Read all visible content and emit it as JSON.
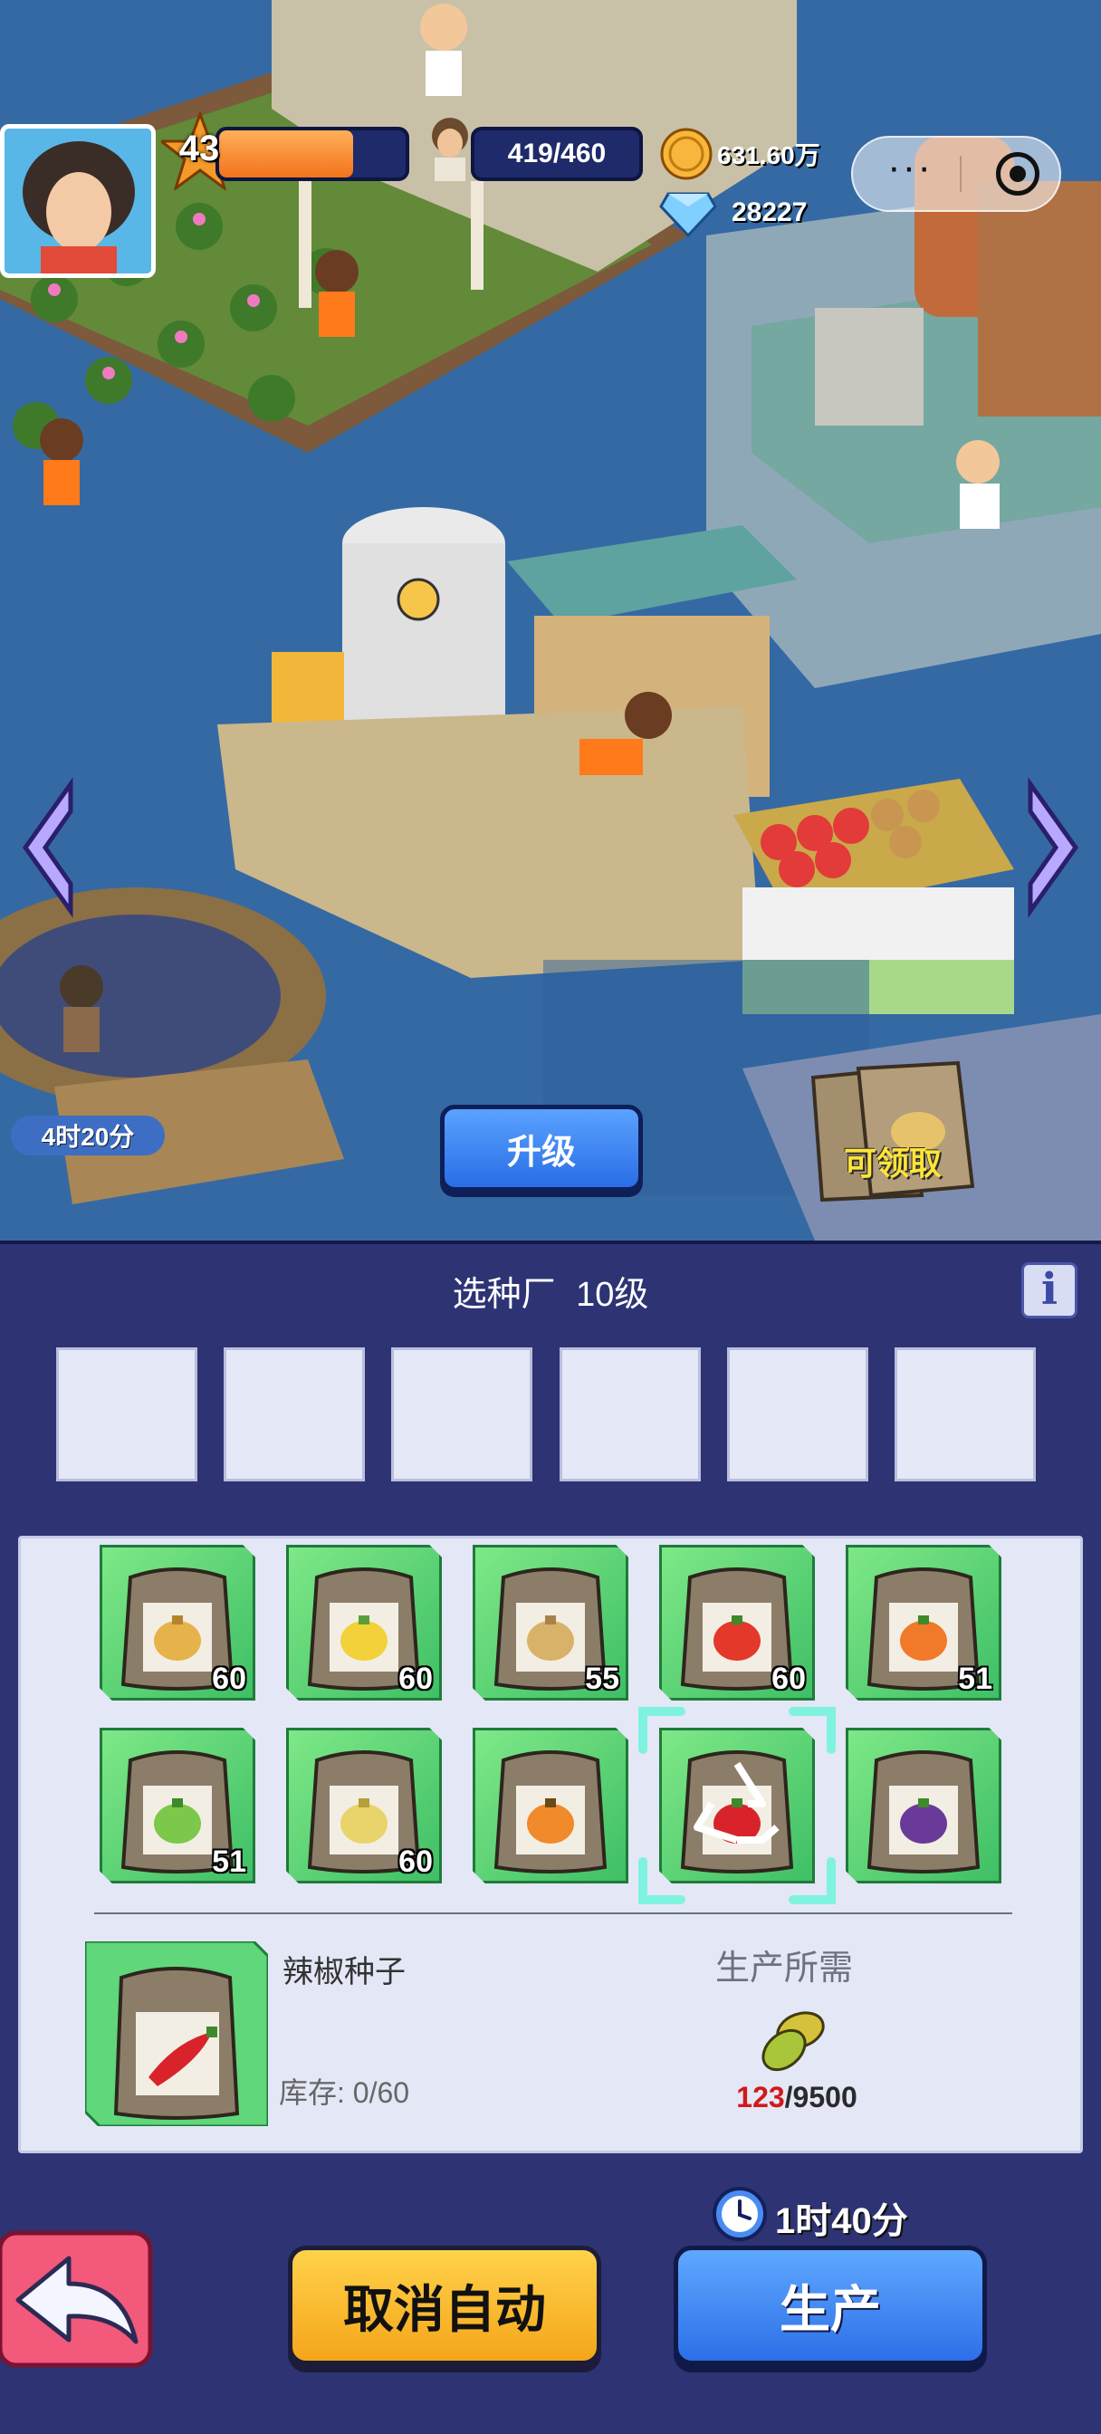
{
  "hud": {
    "level": "43",
    "xp_fraction": 0.72,
    "population": "419/460",
    "coins": "631.60万",
    "gems": "28227"
  },
  "scene": {
    "timer": "4时20分",
    "upgrade_label": "升级",
    "claim_label": "可领取"
  },
  "panel": {
    "building_name": "选种厂",
    "building_level": "10级",
    "info_label": "i",
    "slots_count": 6,
    "seeds": [
      {
        "icon": "wheat-seed-icon",
        "count": "60"
      },
      {
        "icon": "corn-seed-icon",
        "count": "60"
      },
      {
        "icon": "potato-seed-icon",
        "count": "55"
      },
      {
        "icon": "tomato-seed-icon",
        "count": "60"
      },
      {
        "icon": "carrot-seed-icon",
        "count": "51"
      },
      {
        "icon": "cabbage-seed-icon",
        "count": "51"
      },
      {
        "icon": "soybean-seed-icon",
        "count": "60"
      },
      {
        "icon": "pumpkin-seed-icon",
        "count": ""
      },
      {
        "icon": "chili-seed-icon",
        "count": "",
        "selected": true
      },
      {
        "icon": "eggplant-seed-icon",
        "count": ""
      }
    ],
    "detail": {
      "name": "辣椒种子",
      "stock_label": "库存: 0/60"
    },
    "requirement": {
      "title": "生产所需",
      "have": "123",
      "need": "/9500"
    },
    "time": "1时40分",
    "cancel_label": "取消自动",
    "produce_label": "生产"
  },
  "colors": {
    "panel_bg": "#2d3373",
    "seed_tile": "#5fd77a",
    "produce_button": "#2d6fe8",
    "cancel_button": "#f5a51a",
    "required_have": "#d21919"
  }
}
